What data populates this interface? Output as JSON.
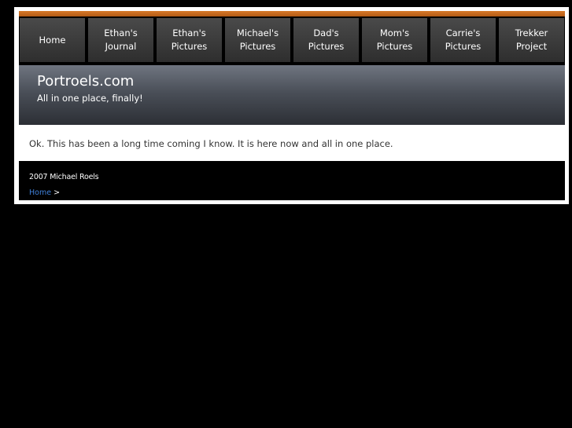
{
  "nav": {
    "items": [
      {
        "label": "Home"
      },
      {
        "label": "Ethan's Journal"
      },
      {
        "label": "Ethan's Pictures"
      },
      {
        "label": "Michael's Pictures"
      },
      {
        "label": "Dad's Pictures"
      },
      {
        "label": "Mom's Pictures"
      },
      {
        "label": "Carrie's Pictures"
      },
      {
        "label": "Trekker Project"
      }
    ]
  },
  "header": {
    "title": "Portroels.com",
    "tagline": "All in one place, finally!"
  },
  "content": {
    "text": "Ok. This has been a long time coming I know. It is here now and all in one place."
  },
  "footer": {
    "copyright": "2007 Michael Roels",
    "breadcrumb_home": "Home",
    "breadcrumb_separator": ">"
  },
  "colors": {
    "accent": "#c86a1e",
    "link": "#3e7fd8",
    "background": "#000000"
  }
}
